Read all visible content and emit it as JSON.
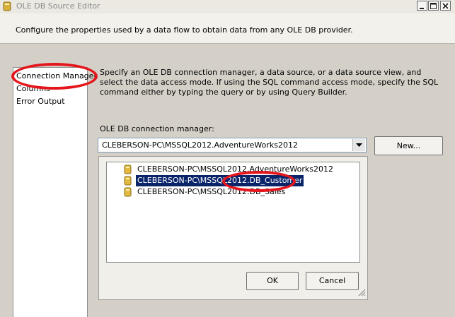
{
  "window": {
    "title": "OLE DB Source Editor"
  },
  "header": {
    "description": "Configure the properties used by a data flow to obtain data from any OLE DB provider."
  },
  "nav": {
    "items": [
      {
        "label": "Connection Manager"
      },
      {
        "label": "Columns"
      },
      {
        "label": "Error Output"
      }
    ]
  },
  "main": {
    "instructions": "Specify an OLE DB connection manager, a data source, or a data source view, and select the data access mode. If using the SQL command access mode, specify the SQL command either by typing the query or by using Query Builder.",
    "connection_label": "OLE DB connection manager:",
    "connection_value": "CLEBERSON-PC\\MSSQL2012.AdventureWorks2012",
    "new_button": "New..."
  },
  "popup": {
    "items": [
      {
        "label": "CLEBERSON-PC\\MSSQL2012.AdventureWorks2012"
      },
      {
        "label": "CLEBERSON-PC\\MSSQL2012.DB_Customer"
      },
      {
        "label": "CLEBERSON-PC\\MSSQL2012.DB_Sales"
      }
    ],
    "selected_index": 1,
    "ok_button": "OK",
    "cancel_button": "Cancel"
  },
  "colors": {
    "selection": "#0a246a",
    "annotation": "#e4161c"
  }
}
